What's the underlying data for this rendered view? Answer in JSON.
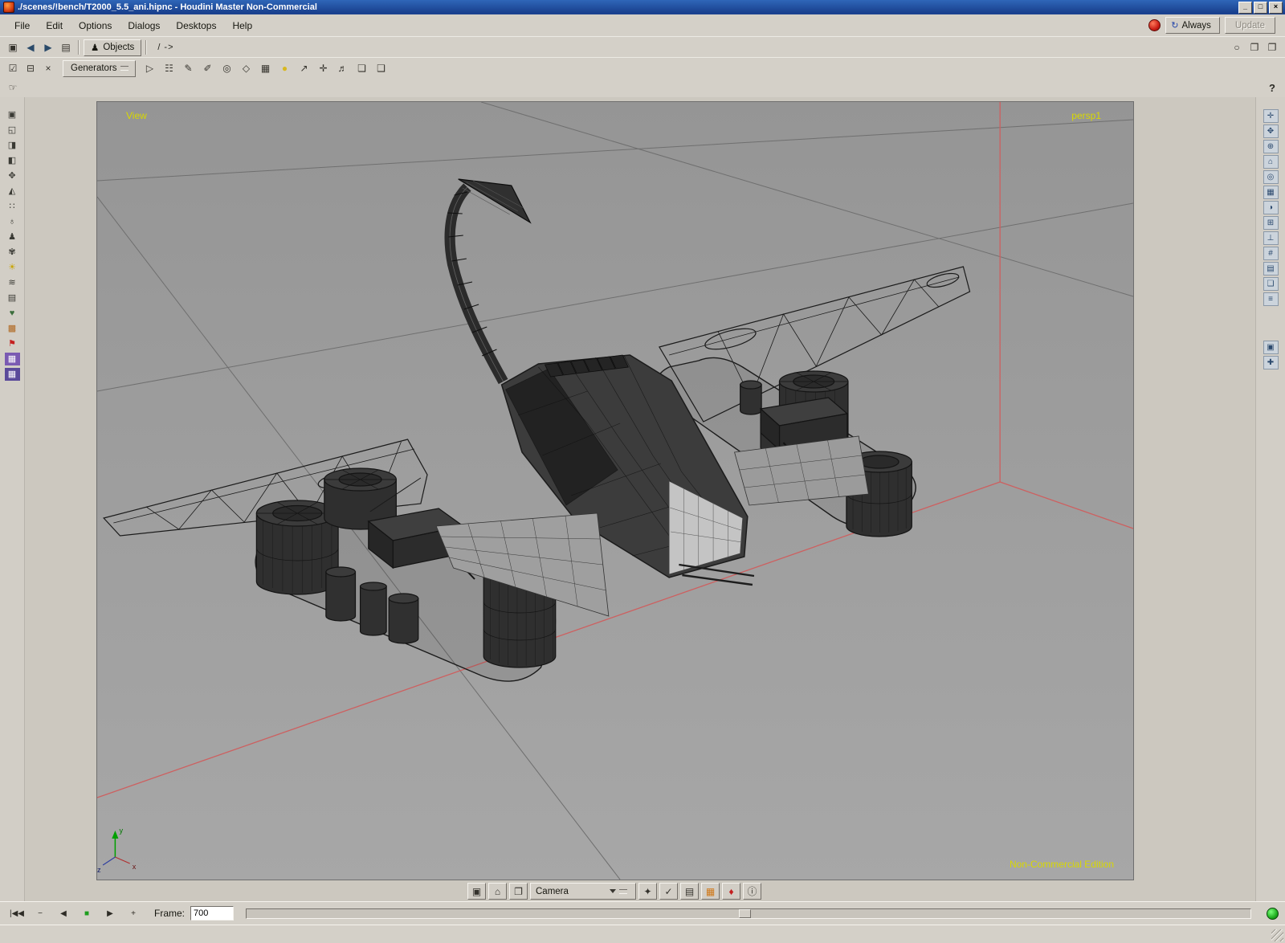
{
  "window": {
    "title": "./scenes/!bench/T2000_5.5_ani.hipnc - Houdini Master Non-Commercial",
    "minimize": "_",
    "maximize": "□",
    "close": "×"
  },
  "menu_bar": {
    "items": [
      {
        "label": "File"
      },
      {
        "label": "Edit"
      },
      {
        "label": "Options"
      },
      {
        "label": "Dialogs"
      },
      {
        "label": "Desktops"
      },
      {
        "label": "Help"
      }
    ],
    "always_icon": "↻",
    "always_button": "Always",
    "update_button": "Update"
  },
  "path_bar": {
    "left_icons": [
      {
        "name": "pane-type-icon",
        "glyph": "▣"
      },
      {
        "name": "back-arrow-icon",
        "glyph": "◀",
        "color": "#2a4a6a"
      },
      {
        "name": "forward-arrow-icon",
        "glyph": "▶",
        "color": "#2a4a6a"
      },
      {
        "name": "export-pane-icon",
        "glyph": "▤"
      }
    ],
    "context_icon": "♟",
    "context_label": "Objects",
    "path_value": "/ ->",
    "right_icons": [
      {
        "name": "link-circle-icon",
        "glyph": "○"
      },
      {
        "name": "copy-pane-icon",
        "glyph": "❐"
      },
      {
        "name": "split-pane-icon",
        "glyph": "❐"
      }
    ]
  },
  "tool_bar": {
    "left_icons": [
      {
        "name": "tab-pointer-icon",
        "glyph": "☑"
      },
      {
        "name": "pin-pair-icon",
        "glyph": "⊟"
      },
      {
        "name": "delete-icon",
        "glyph": "×"
      }
    ],
    "generators_label": "Generators",
    "tools": [
      {
        "name": "select-tool-icon",
        "glyph": "▷"
      },
      {
        "name": "network-tool-icon",
        "glyph": "☷"
      },
      {
        "name": "edit-pencil-icon",
        "glyph": "✎"
      },
      {
        "name": "lasso-tool-icon",
        "glyph": "✐"
      },
      {
        "name": "magnet-tool-icon",
        "glyph": "◎"
      },
      {
        "name": "primitive-tool-icon",
        "glyph": "◇"
      },
      {
        "name": "grid-tool-icon",
        "glyph": "▦"
      },
      {
        "name": "paint-tool-icon",
        "glyph": "●",
        "color": "#d8b820"
      },
      {
        "name": "probe-tool-icon",
        "glyph": "↗"
      },
      {
        "name": "transform-tool-icon",
        "glyph": "✛"
      },
      {
        "name": "audio-tool-icon",
        "glyph": "♬"
      },
      {
        "name": "render-view-icon",
        "glyph": "❏"
      },
      {
        "name": "snapshot-icon",
        "glyph": "❑"
      }
    ]
  },
  "row3": {
    "help_label": "?"
  },
  "left_toolbar": {
    "items": [
      {
        "name": "viewport-layout-icon",
        "glyph": "▣"
      },
      {
        "name": "pane-split-icon",
        "glyph": "◱"
      },
      {
        "name": "image-view-icon",
        "glyph": "◨"
      },
      {
        "name": "mirror-view-icon",
        "glyph": "◧"
      },
      {
        "name": "move-tool-icon",
        "glyph": "✥"
      },
      {
        "name": "scale-tool-icon",
        "glyph": "◭"
      },
      {
        "name": "points-icon",
        "glyph": "∷"
      },
      {
        "name": "pose-icon",
        "glyph": "♁"
      },
      {
        "name": "character-icon",
        "glyph": "♟"
      },
      {
        "name": "flower-icon",
        "glyph": "✾"
      },
      {
        "name": "light-icon",
        "glyph": "☀",
        "color": "#c8a400"
      },
      {
        "name": "waves-icon",
        "glyph": "≋"
      },
      {
        "name": "sheet-icon",
        "glyph": "▤"
      },
      {
        "name": "bone-icon",
        "glyph": "♥",
        "color": "#3c6e3c"
      },
      {
        "name": "grid-icon",
        "glyph": "▩",
        "color": "#b06820"
      },
      {
        "name": "flag-icon",
        "glyph": "⚑",
        "color": "#c42020"
      },
      {
        "name": "texture-a-icon",
        "glyph": "▦",
        "color": "#ffffff",
        "bg": "#7a5ab2"
      },
      {
        "name": "texture-b-icon",
        "glyph": "▦",
        "color": "#ffffff",
        "bg": "#5a4a9a"
      }
    ]
  },
  "right_toolbar": {
    "items": [
      {
        "name": "view-tool-icon",
        "glyph": "✛"
      },
      {
        "name": "pan-tool-icon",
        "glyph": "✥"
      },
      {
        "name": "zoom-tool-icon",
        "glyph": "⊕"
      },
      {
        "name": "home-view-icon",
        "glyph": "⌂"
      },
      {
        "name": "frame-view-icon",
        "glyph": "◎"
      },
      {
        "name": "ortho-toggle-icon",
        "glyph": "▦"
      },
      {
        "name": "shade-mode-icon",
        "glyph": "◑"
      },
      {
        "name": "wireframe-mode-icon",
        "glyph": "⊞"
      },
      {
        "name": "normals-icon",
        "glyph": "⊥"
      },
      {
        "name": "snap-icon",
        "glyph": "#"
      },
      {
        "name": "grid-toggle-icon",
        "glyph": "▤"
      },
      {
        "name": "camera-lock-icon",
        "glyph": "❏"
      },
      {
        "name": "view-options-icon",
        "glyph": "≡"
      },
      {
        "name": "layer-a-icon",
        "glyph": "▣"
      },
      {
        "name": "layer-b-icon",
        "glyph": "✚"
      }
    ]
  },
  "viewport": {
    "view_label": "View",
    "camera_label": "persp1",
    "edition_label": "Non-Commercial Edition",
    "axis": {
      "x": "x",
      "y": "y",
      "z": "z"
    }
  },
  "camera_bar": {
    "left_icons": [
      {
        "name": "view-mode-icon",
        "glyph": "▣"
      },
      {
        "name": "home-icon",
        "glyph": "⌂"
      },
      {
        "name": "copy-view-icon",
        "glyph": "❐"
      }
    ],
    "camera_select": "Camera",
    "right_icons": [
      {
        "name": "key-icon",
        "glyph": "✦"
      },
      {
        "name": "select-check-icon",
        "glyph": "✓"
      },
      {
        "name": "layers-icon",
        "glyph": "▤"
      },
      {
        "name": "material-icon",
        "glyph": "▦",
        "color": "#d07818"
      },
      {
        "name": "flag-red-icon",
        "glyph": "♦",
        "color": "#c42020"
      },
      {
        "name": "info-icon",
        "glyph": "ⓘ"
      }
    ]
  },
  "playbar": {
    "buttons": [
      {
        "name": "go-start-button",
        "glyph": "|◀◀"
      },
      {
        "name": "step-back-button",
        "glyph": "−"
      },
      {
        "name": "play-reverse-button",
        "glyph": "◀"
      },
      {
        "name": "stop-button",
        "glyph": "■",
        "color": "#1e9e1e"
      },
      {
        "name": "play-button",
        "glyph": "▶"
      },
      {
        "name": "step-forward-button",
        "glyph": "+"
      }
    ],
    "frame_label": "Frame:",
    "frame_value": "700",
    "slider_pos_percent": 49
  },
  "colors": {
    "titlebar_blue": "#1c4e9c",
    "viewport_gray": "#9c9c9c",
    "label_yellow": "#d8d800",
    "axis_red": "#cd6060",
    "grid_gray": "#6f6f6f"
  }
}
